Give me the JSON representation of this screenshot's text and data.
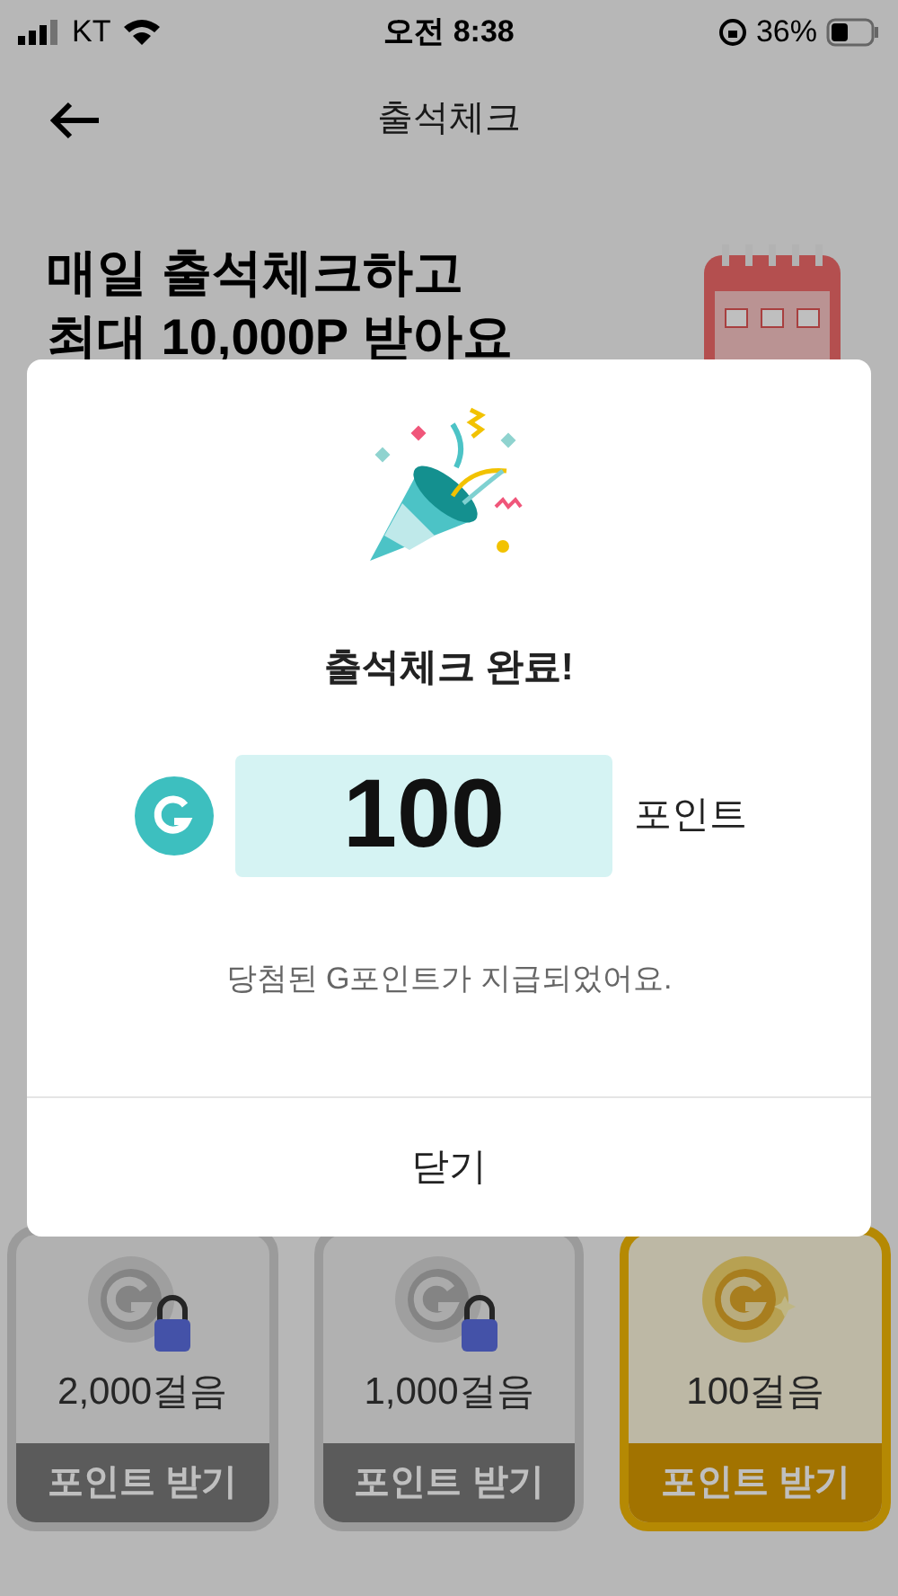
{
  "status_bar": {
    "carrier": "KT",
    "time": "오전 8:38",
    "battery": "36%"
  },
  "header": {
    "title": "출석체크"
  },
  "headline": [
    "매일 출석체크하고",
    "최대 10,000P 받아요"
  ],
  "dialog": {
    "title": "출석체크 완료!",
    "points": "100",
    "unit": "포인트",
    "message": "당첨된 G포인트가 지급되었어요.",
    "close": "닫기"
  },
  "rewards": [
    {
      "steps": "2,000걸음",
      "button": "포인트 받기",
      "locked": true
    },
    {
      "steps": "1,000걸음",
      "button": "포인트 받기",
      "locked": true
    },
    {
      "steps": "100걸음",
      "button": "포인트 받기",
      "locked": false
    }
  ]
}
